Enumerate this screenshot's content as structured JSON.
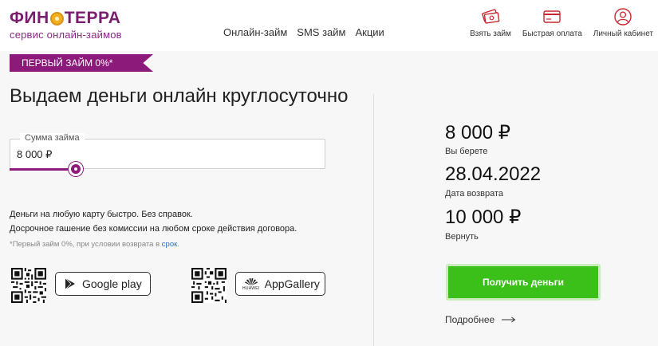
{
  "logo": {
    "part1": "ФИН",
    "part2": "ТЕРРА",
    "tagline": "сервис онлайн-займов"
  },
  "nav": [
    {
      "label": "Онлайн-займ"
    },
    {
      "label": "SMS займ"
    },
    {
      "label": "Акции"
    }
  ],
  "header_actions": [
    {
      "label": "Взять займ",
      "icon": "money-icon"
    },
    {
      "label": "Быстрая оплата",
      "icon": "card-icon"
    },
    {
      "label": "Личный кабинет",
      "icon": "user-icon"
    }
  ],
  "badge": "ПЕРВЫЙ ЗАЙМ 0%*",
  "title": "Выдаем деньги онлайн круглосуточно",
  "amount": {
    "label": "Сумма займа",
    "value": "8 000 ₽"
  },
  "info": {
    "line1": "Деньги на любую карту быстро. Без справок.",
    "line2": "Досрочное гашение без комиссии на любом сроке действия договора.",
    "note_prefix": "*Первый займ 0%, при условии возврата в ",
    "note_link": "срок",
    "note_suffix": "."
  },
  "stores": {
    "google": "Google play",
    "huawei": "AppGallery",
    "huawei_small": "HUAWEI"
  },
  "summary": {
    "take_value": "8 000 ₽",
    "take_label": "Вы берете",
    "date_value": "28.04.2022",
    "date_label": "Дата возврата",
    "return_value": "10 000 ₽",
    "return_label": "Вернуть"
  },
  "cta": "Получить деньги",
  "more": "Подробнее",
  "colors": {
    "brand": "#8b1a7a",
    "cta": "#3ac019",
    "link": "#2b6cc4"
  }
}
